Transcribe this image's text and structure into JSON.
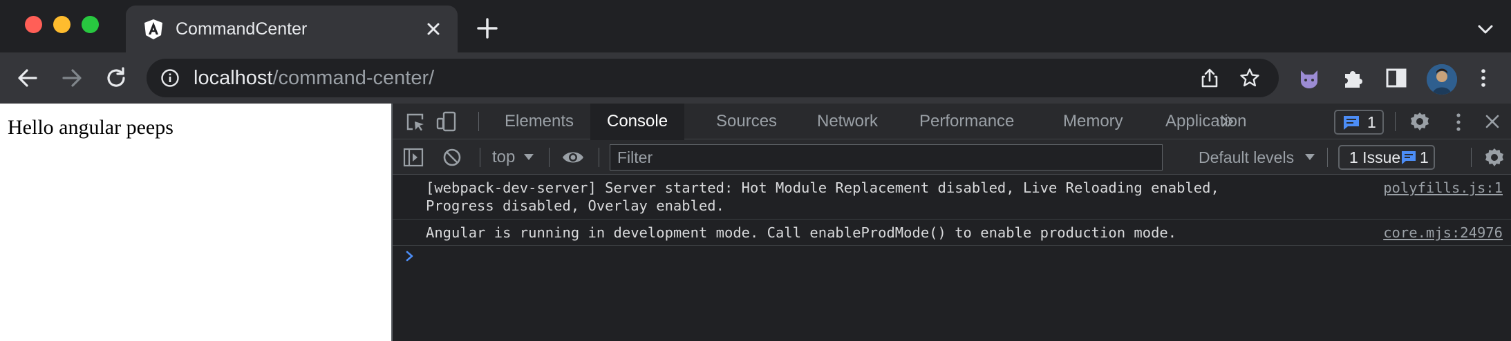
{
  "tab": {
    "title": "CommandCenter",
    "favicon": "angular-logo-icon"
  },
  "toolbar": {
    "url_host": "localhost",
    "url_path": "/command-center/"
  },
  "page": {
    "text": "Hello angular peeps"
  },
  "devtools": {
    "tabs": [
      {
        "label": "Elements"
      },
      {
        "label": "Console"
      },
      {
        "label": "Sources"
      },
      {
        "label": "Network"
      },
      {
        "label": "Performance"
      },
      {
        "label": "Memory"
      },
      {
        "label": "Application"
      }
    ],
    "active_tab": "Console",
    "messages_count": "1",
    "console_toolbar": {
      "context": "top",
      "filter_placeholder": "Filter",
      "levels": "Default levels",
      "issues_label": "1 Issue:",
      "issues_count": "1"
    },
    "messages": [
      {
        "line1": "[webpack-dev-server] Server started: Hot Module Replacement disabled, Live Reloading enabled,",
        "line2": "Progress disabled, Overlay enabled.",
        "source": "polyfills.js:1"
      },
      {
        "line1": "Angular is running in development mode. Call enableProdMode() to enable production mode.",
        "source": "core.mjs:24976"
      }
    ]
  },
  "colors": {
    "chrome_dark": "#202124",
    "toolbar": "#35363a",
    "devtools_bar": "#292a2d",
    "accent_blue": "#4c8df6",
    "text_light": "#e8eaed",
    "text_muted": "#9aa0a6"
  }
}
